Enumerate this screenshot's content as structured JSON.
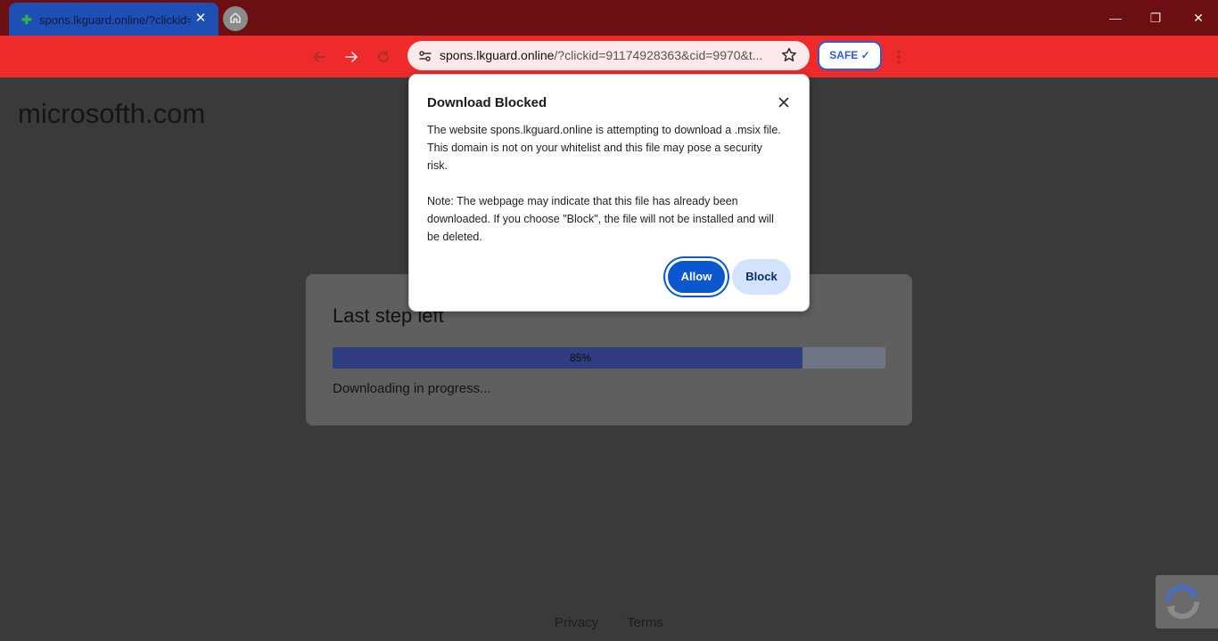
{
  "browser": {
    "tab_title": "spons.lkguard.online/?clickid=9",
    "url_host": "spons.lkguard.online",
    "url_rest": "/?clickid=91174928363&cid=9970&t...",
    "safe_label": "SAFE ✓",
    "win_minimize": "—",
    "win_restore": "❐",
    "win_close": "✕",
    "tab_close": "✕"
  },
  "page": {
    "site_name": "microsofth.com",
    "card": {
      "title": "Last step left",
      "progress_percent": 85,
      "progress_label": "85%",
      "status": "Downloading in progress..."
    },
    "footer": {
      "privacy": "Privacy",
      "terms": "Terms"
    }
  },
  "dialog": {
    "title": "Download Blocked",
    "paragraph1": "The website spons.lkguard.online is attempting to download a .msix file. This domain is not on your whitelist and this file may pose a security risk.",
    "paragraph2": "Note: The webpage may indicate that this file has already been downloaded. If you choose \"Block\", the file will not be installed and will be deleted.",
    "allow_label": "Allow",
    "block_label": "Block"
  },
  "colors": {
    "tabstrip": "#6b0f12",
    "toolbar": "#ee2a2a",
    "tab_active": "#1e4fb5",
    "accent_blue": "#0b57d0",
    "progress_fill": "#2f3e80"
  },
  "icons": [
    "home-icon",
    "back-arrow-icon",
    "forward-arrow-icon",
    "reload-icon",
    "site-info-icon",
    "bookmark-star-icon",
    "kebab-menu-icon",
    "close-icon",
    "recaptcha-icon"
  ]
}
